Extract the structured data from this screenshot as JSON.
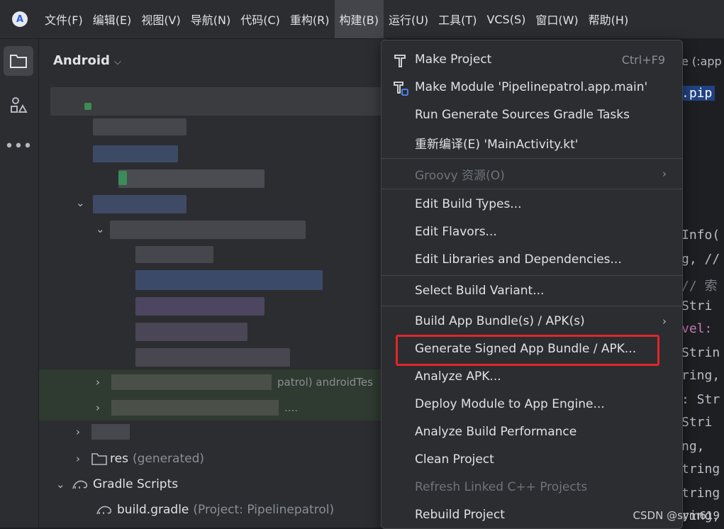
{
  "menubar": {
    "items": [
      "文件(F)",
      "编辑(E)",
      "视图(V)",
      "导航(N)",
      "代码(C)",
      "重构(R)",
      "构建(B)",
      "运行(U)",
      "工具(T)",
      "VCS(S)",
      "窗口(W)",
      "帮助(H)"
    ],
    "active_index": 6
  },
  "project": {
    "title": "Android",
    "rows": {
      "patrol_androidtest": "patrol)  androidTes",
      "collapsed_dots": "....",
      "res_name": "res",
      "res_suffix": "(generated)",
      "gradle_scripts": "Gradle Scripts",
      "build_gradle": "build.gradle",
      "build_gradle_suffix": "(Project: Pipelinepatrol)"
    }
  },
  "editor": {
    "tab_label": "e (:app",
    "lines": [
      ".pip",
      "Info(",
      "g, //",
      "// 索",
      " Stri",
      "vel: ",
      "Strin",
      "ring,",
      ": Str",
      " Stri",
      "ng,",
      "tring",
      "tring",
      "ring,"
    ]
  },
  "dropdown": {
    "items": [
      {
        "label": "Make Project",
        "shortcut": "Ctrl+F9",
        "icon": "hammer-icon"
      },
      {
        "label": "Make Module 'Pipelinepatrol.app.main'",
        "icon": "hammer-module-icon"
      },
      {
        "label": "Run Generate Sources Gradle Tasks"
      },
      {
        "label": "重新编译(E) 'MainActivity.kt'"
      },
      {
        "label": "Groovy 资源(O)",
        "disabled": true,
        "submenu": true
      },
      {
        "label": "Edit Build Types..."
      },
      {
        "label": "Edit Flavors..."
      },
      {
        "label": "Edit Libraries and Dependencies..."
      },
      {
        "label": "Select Build Variant..."
      },
      {
        "label": "Build App Bundle(s) / APK(s)",
        "submenu": true
      },
      {
        "label": "Generate Signed App Bundle / APK..."
      },
      {
        "label": "Analyze APK..."
      },
      {
        "label": "Deploy Module to App Engine..."
      },
      {
        "label": "Analyze Build Performance"
      },
      {
        "label": "Clean Project"
      },
      {
        "label": "Refresh Linked C++ Projects",
        "disabled": true
      },
      {
        "label": "Rebuild Project"
      }
    ]
  },
  "watermark": "CSDN @sym619",
  "colors": {
    "highlight": "#e12727",
    "menu_bg": "#2b2d30",
    "editor_bg": "#1e1f22",
    "accent": "#2b5fd9"
  }
}
